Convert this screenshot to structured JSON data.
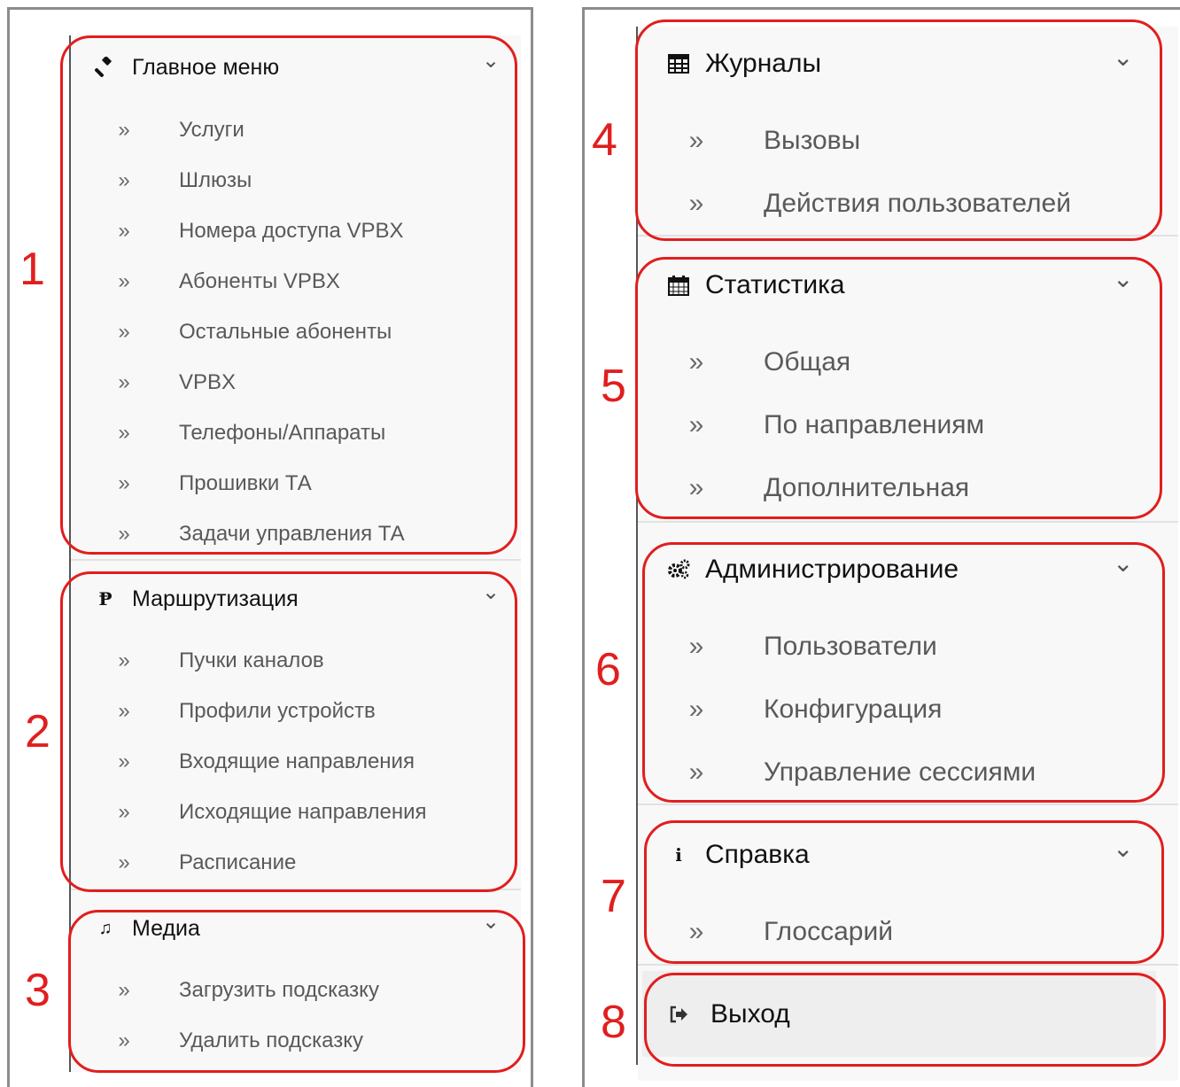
{
  "groups": [
    {
      "title": "Главное меню",
      "icon": "gavel-icon",
      "items": [
        "Услуги",
        "Шлюзы",
        "Номера доступа VPBX",
        "Абоненты VPBX",
        "Остальные абоненты",
        "VPBX",
        "Телефоны/Аппараты",
        "Прошивки ТА",
        "Задачи управления ТА"
      ]
    },
    {
      "title": "Маршрутизация",
      "icon": "route-icon",
      "items": [
        "Пучки каналов",
        "Профили устройств",
        "Входящие направления",
        "Исходящие направления",
        "Расписание"
      ]
    },
    {
      "title": "Медиа",
      "icon": "music-icon",
      "items": [
        "Загрузить подсказку",
        "Удалить подсказку"
      ]
    },
    {
      "title": "Журналы",
      "icon": "table-icon",
      "items": [
        "Вызовы",
        "Действия пользователей"
      ]
    },
    {
      "title": "Статистика",
      "icon": "calendar-icon",
      "items": [
        "Общая",
        "По направлениям",
        "Дополнительная"
      ]
    },
    {
      "title": "Администрирование",
      "icon": "gears-icon",
      "items": [
        "Пользователи",
        "Конфигурация",
        "Управление сессиями"
      ]
    },
    {
      "title": "Справка",
      "icon": "info-icon",
      "items": [
        "Глоссарий"
      ]
    }
  ],
  "logout": {
    "label": "Выход",
    "icon": "sign-out-icon"
  },
  "bullet": "»",
  "chevron": "⌄",
  "annotations": [
    "1",
    "2",
    "3",
    "4",
    "5",
    "6",
    "7",
    "8"
  ],
  "colors": {
    "annotation": "#e11e1e",
    "menu_bg": "#f8f8f8",
    "item_text": "#595959",
    "header_text": "#111111"
  }
}
